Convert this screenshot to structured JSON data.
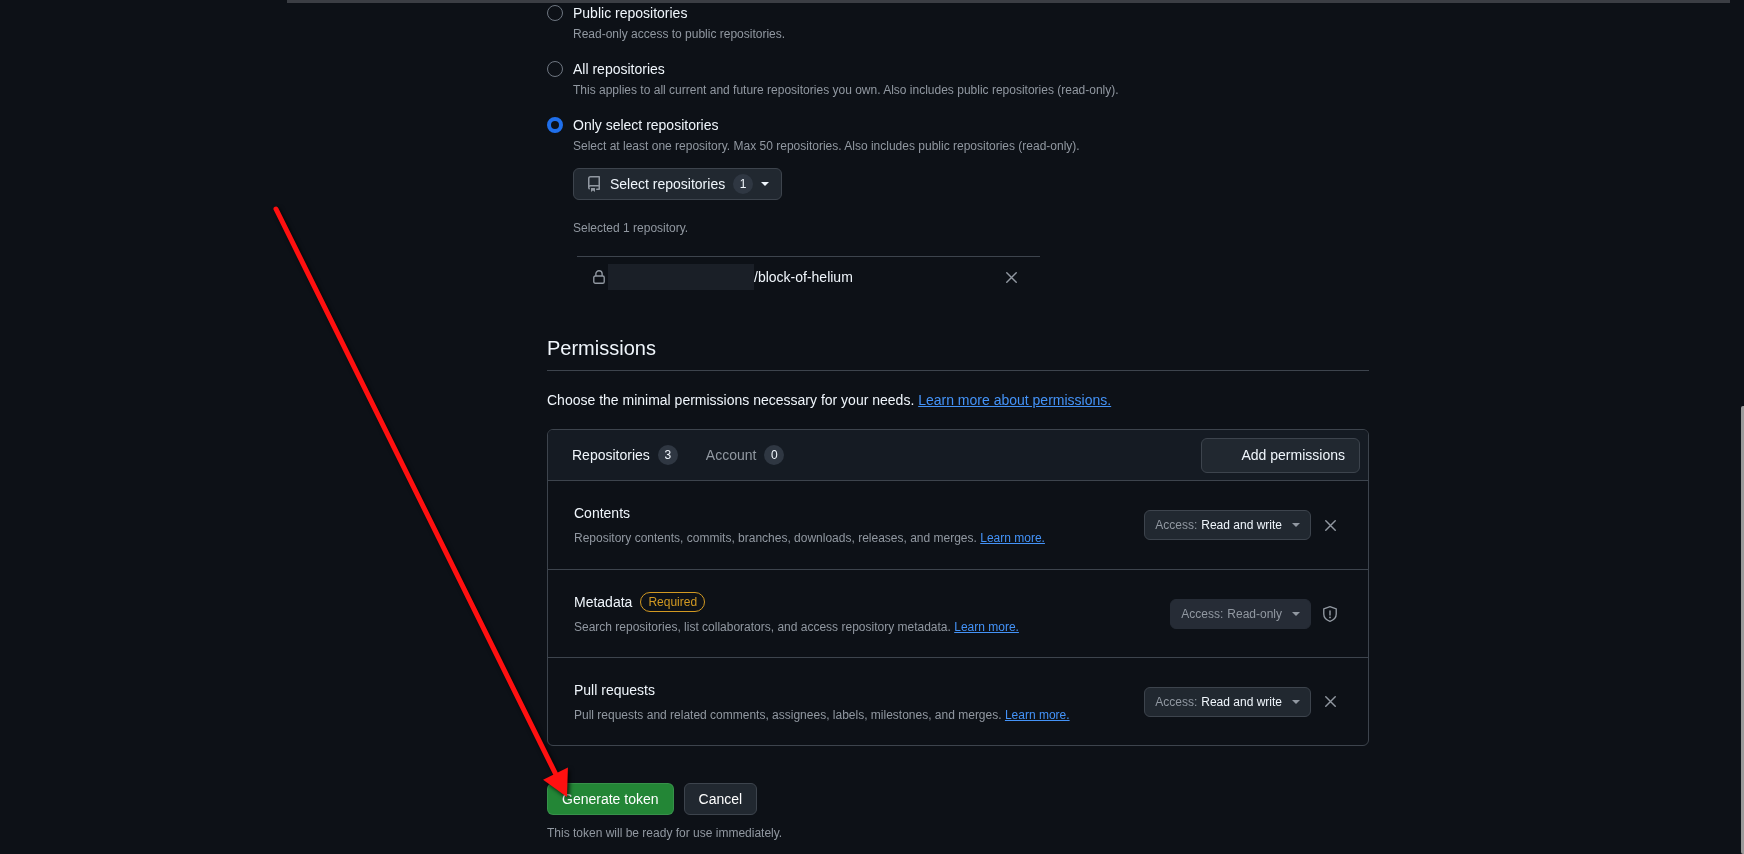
{
  "repository_access": {
    "options": [
      {
        "label": "Public repositories",
        "description": "Read-only access to public repositories.",
        "selected": false
      },
      {
        "label": "All repositories",
        "description": "This applies to all current and future repositories you own. Also includes public repositories (read-only).",
        "selected": false
      },
      {
        "label": "Only select repositories",
        "description": "Select at least one repository. Max 50 repositories. Also includes public repositories (read-only).",
        "selected": true
      }
    ],
    "select_button": {
      "label": "Select repositories",
      "count": "1"
    },
    "selected_summary": "Selected 1 repository.",
    "selected_repos": [
      {
        "name": "/block-of-helium",
        "owner_redacted": true
      }
    ]
  },
  "permissions": {
    "title": "Permissions",
    "intro": "Choose the minimal permissions necessary for your needs.",
    "intro_link": "Learn more about permissions.",
    "tabs": [
      {
        "label": "Repositories",
        "count": "3",
        "selected": true
      },
      {
        "label": "Account",
        "count": "0",
        "selected": false
      }
    ],
    "add_button": "Add permissions",
    "rows": [
      {
        "kind": "removable",
        "name": "Contents",
        "description": "Repository contents, commits, branches, downloads, releases, and merges.",
        "link": "Learn more.",
        "access_label": "Access:",
        "access_value": "Read and write",
        "disabled": false
      },
      {
        "kind": "required",
        "name": "Metadata",
        "badge": "Required",
        "description": "Search repositories, list collaborators, and access repository metadata.",
        "link": "Learn more.",
        "access_label": "Access:",
        "access_value": "Read-only",
        "disabled": true
      },
      {
        "kind": "removable",
        "name": "Pull requests",
        "description": "Pull requests and related comments, assignees, labels, milestones, and merges.",
        "link": "Learn more.",
        "access_label": "Access:",
        "access_value": "Read and write",
        "disabled": false
      }
    ]
  },
  "actions": {
    "buttons": [
      {
        "kind": "primary",
        "label": "Generate token"
      },
      {
        "kind": "secondary",
        "label": "Cancel"
      }
    ],
    "note": "This token will be ready for use immediately."
  }
}
